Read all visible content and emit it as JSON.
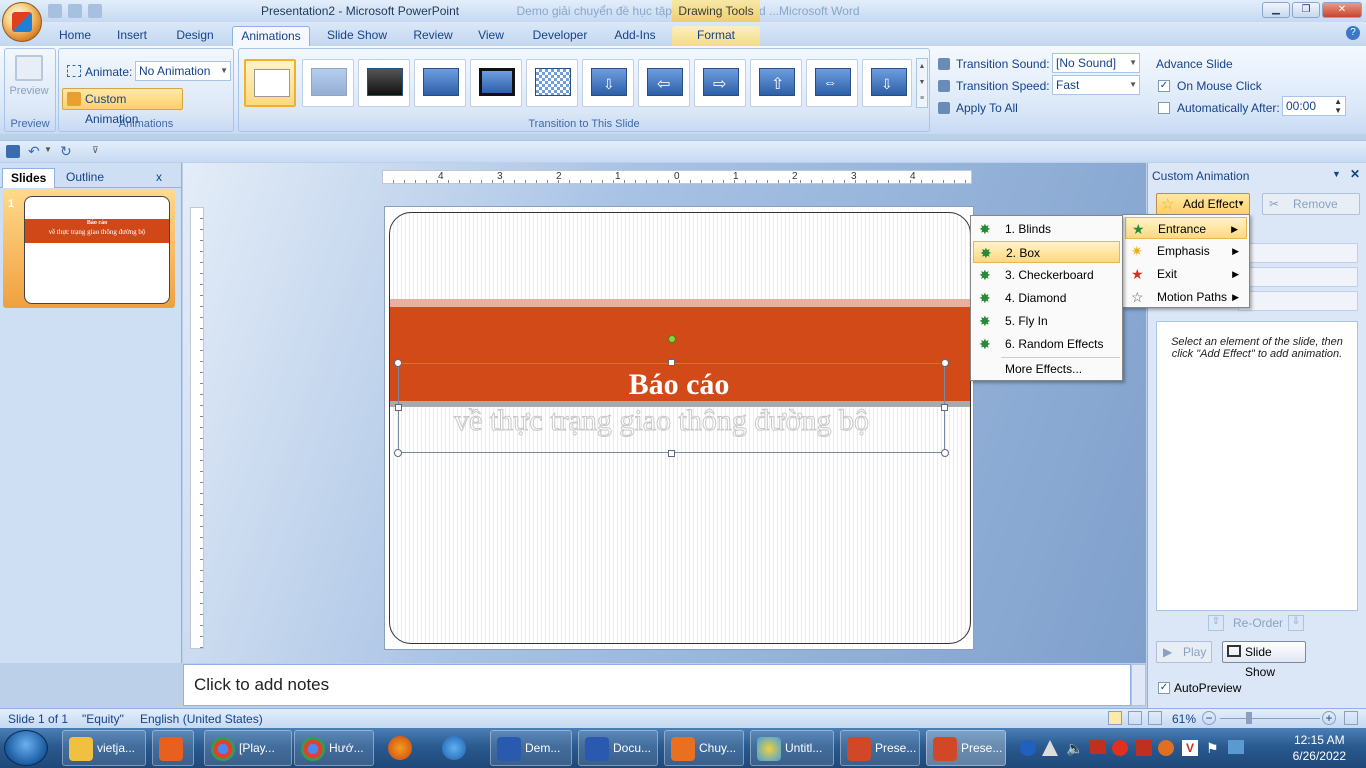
{
  "titlebar": {
    "title": "Presentation2 - Microsoft PowerPoint",
    "bg_title": "Demo giải chuyển đề hục tập 1 Microsoft Word ...Microsoft Word",
    "contextual": "Drawing Tools"
  },
  "tabs": [
    "Home",
    "Insert",
    "Design",
    "Animations",
    "Slide Show",
    "Review",
    "View",
    "Developer",
    "Add-Ins",
    "Format"
  ],
  "ribbon": {
    "preview_label": "Preview",
    "preview_group": "Preview",
    "animate_label": "Animate:",
    "animate_value": "No Animation",
    "custom_animation": "Custom Animation",
    "animations_group": "Animations",
    "transition_group": "Transition to This Slide",
    "transition_sound_label": "Transition Sound:",
    "transition_sound_value": "[No Sound]",
    "transition_speed_label": "Transition Speed:",
    "transition_speed_value": "Fast",
    "apply_to_all": "Apply To All",
    "advance_slide": "Advance Slide",
    "on_mouse_click": "On Mouse Click",
    "on_mouse_click_checked": true,
    "automatically_after": "Automatically After:",
    "automatically_after_value": "00:00"
  },
  "leftpane": {
    "tab_slides": "Slides",
    "tab_outline": "Outline",
    "close": "x",
    "slide_number": "1"
  },
  "slide": {
    "title": "Báo cáo",
    "subtitle": "về thực trạng giao thông đường bộ"
  },
  "ruler": {
    "h_ticks": [
      "4",
      "3",
      "2",
      "1",
      "0",
      "1",
      "2",
      "3",
      "4"
    ]
  },
  "notes": {
    "placeholder": "Click to add notes"
  },
  "custom_anim": {
    "header": "Custom Animation",
    "add_effect": "Add Effect",
    "remove": "Remove",
    "info": "Select an element of the slide, then click \"Add Effect\" to add animation.",
    "reorder": "Re-Order",
    "play": "Play",
    "slide_show": "Slide Show",
    "autopreview": "AutoPreview",
    "autopreview_checked": true
  },
  "menu_main": [
    {
      "label": "Entrance",
      "highlighted": true
    },
    {
      "label": "Emphasis",
      "highlighted": false
    },
    {
      "label": "Exit",
      "highlighted": false
    },
    {
      "label": "Motion Paths",
      "highlighted": false
    }
  ],
  "menu_entrance": [
    {
      "label": "1. Blinds",
      "highlighted": false
    },
    {
      "label": "2. Box",
      "highlighted": true
    },
    {
      "label": "3. Checkerboard",
      "highlighted": false
    },
    {
      "label": "4. Diamond",
      "highlighted": false
    },
    {
      "label": "5. Fly In",
      "highlighted": false
    },
    {
      "label": "6. Random Effects",
      "highlighted": false
    }
  ],
  "more_effects": "More Effects...",
  "statusbar": {
    "slide": "Slide 1 of 1",
    "theme": "\"Equity\"",
    "language": "English (United States)",
    "zoom": "61%"
  },
  "taskbar": {
    "items": [
      "vietja...",
      "",
      "[Play...",
      "Hướ...",
      "",
      "",
      "Dem...",
      "Docu...",
      "Chuy...",
      "Untitl...",
      "Prese...",
      "Prese..."
    ],
    "time": "12:15 AM",
    "date": "6/26/2022"
  },
  "colors": {
    "accent": "#d24a18",
    "ribbon_bg": "#dbe8f8",
    "highlight": "#ffd880"
  }
}
